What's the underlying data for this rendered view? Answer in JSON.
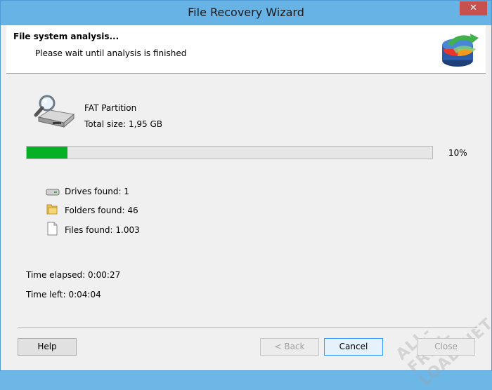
{
  "window": {
    "title": "File Recovery Wizard",
    "close_glyph": "✕"
  },
  "header": {
    "title": "File system analysis...",
    "subtitle": "Please wait until analysis is finished"
  },
  "partition": {
    "name": "FAT Partition",
    "size": "Total size: 1,95 GB"
  },
  "progress": {
    "percent": 10,
    "label": "10%",
    "fill_color": "#06b025"
  },
  "stats": {
    "drives": "Drives found: 1",
    "folders": "Folders found: 46",
    "files": "Files found: 1.003"
  },
  "time": {
    "elapsed": "Time elapsed: 0:00:27",
    "left": "Time left: 0:04:04"
  },
  "buttons": {
    "help": "Help",
    "back": "< Back",
    "cancel": "Cancel",
    "close": "Close"
  },
  "watermark": "ALL-FREE-LOAD.NET",
  "icons": {
    "drive_search": "drive-search-icon",
    "drive": "drive-icon",
    "folder": "folder-icon",
    "file": "file-icon",
    "logo": "app-logo-icon"
  }
}
